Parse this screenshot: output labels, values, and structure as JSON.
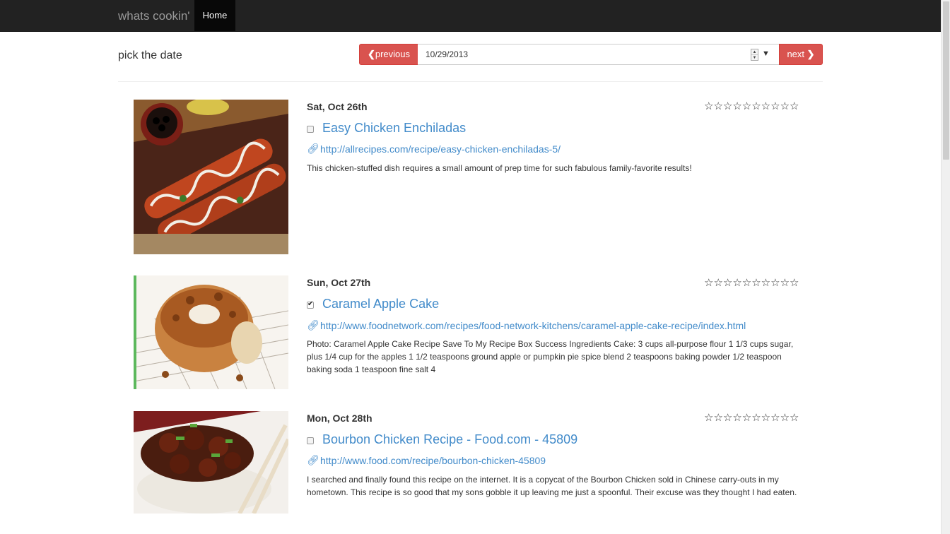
{
  "navbar": {
    "brand": "whats cookin'",
    "home_label": "Home"
  },
  "picker": {
    "label": "pick the date",
    "prev_label": "previous",
    "next_label": "next",
    "date_value": "10/29/2013"
  },
  "entries": [
    {
      "day": "Sat, Oct 26th",
      "stars": "☆☆☆☆☆☆☆☆☆☆",
      "checked": false,
      "title": "Easy Chicken Enchiladas",
      "url": "http://allrecipes.com/recipe/easy-chicken-enchiladas-5/",
      "description": "This chicken-stuffed dish requires a small amount of prep time for such fabulous family-favorite results!"
    },
    {
      "day": "Sun, Oct 27th",
      "stars": "☆☆☆☆☆☆☆☆☆☆",
      "checked": true,
      "title": "Caramel Apple Cake",
      "url": "http://www.foodnetwork.com/recipes/food-network-kitchens/caramel-apple-cake-recipe/index.html",
      "description": "Photo: Caramel Apple Cake Recipe Save To My Recipe Box Success Ingredients Cake: 3 cups all-purpose flour 1 1/3 cups sugar, plus 1/4 cup for the apples 1 1/2 teaspoons ground apple or pumpkin pie spice blend 2 teaspoons baking powder 1/2 teaspoon baking soda 1 teaspoon fine salt 4"
    },
    {
      "day": "Mon, Oct 28th",
      "stars": "☆☆☆☆☆☆☆☆☆☆",
      "checked": false,
      "title": "Bourbon Chicken Recipe - Food.com - 45809",
      "url": "http://www.food.com/recipe/bourbon-chicken-45809",
      "description": "I searched and finally found this recipe on the internet. It is a copycat of the Bourbon Chicken sold in Chinese carry-outs in my hometown. This recipe is so good that my sons gobble it up leaving me just a spoonful. Their excuse was they thought I had eaten."
    }
  ],
  "colors": {
    "accent": "#428bca",
    "danger": "#d9534f",
    "selected": "#5cb85c",
    "navbar": "#222222"
  }
}
